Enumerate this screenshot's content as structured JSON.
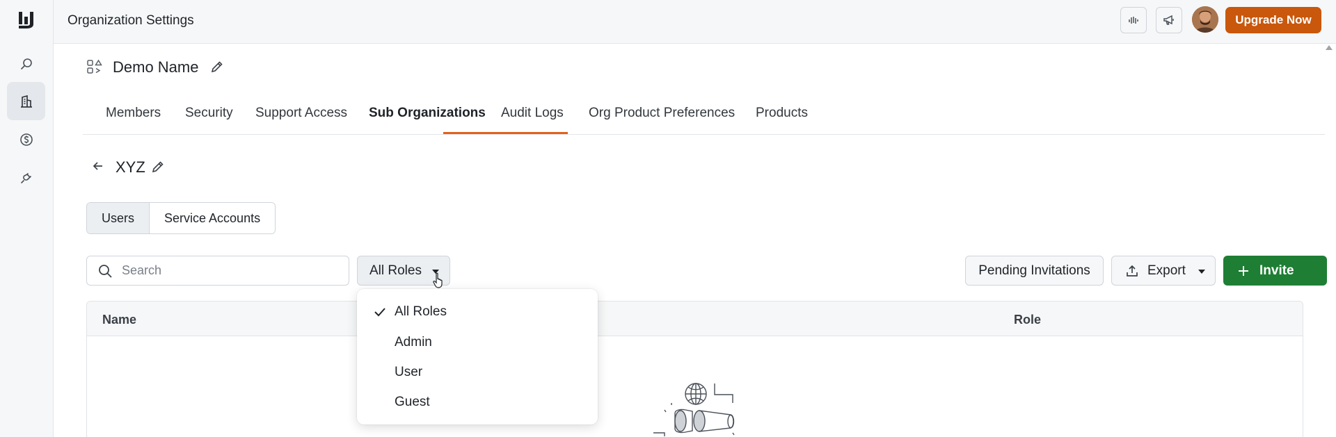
{
  "header": {
    "title": "Organization Settings",
    "upgrade_label": "Upgrade Now"
  },
  "rail": {
    "items": [
      {
        "icon": "search-icon",
        "active": false
      },
      {
        "icon": "building-icon",
        "active": true
      },
      {
        "icon": "dollar-circle-icon",
        "active": false
      },
      {
        "icon": "plug-icon",
        "active": false
      }
    ]
  },
  "org": {
    "name": "Demo Name"
  },
  "tabs": [
    {
      "label": "Members"
    },
    {
      "label": "Security"
    },
    {
      "label": "Support Access"
    },
    {
      "label": "Sub Organizations",
      "active": true
    },
    {
      "label": "Audit Logs"
    },
    {
      "label": "Org Product Preferences"
    },
    {
      "label": "Products"
    }
  ],
  "sub_org": {
    "name": "XYZ"
  },
  "segments": [
    {
      "label": "Users",
      "active": true
    },
    {
      "label": "Service Accounts"
    }
  ],
  "toolbar": {
    "search_placeholder": "Search",
    "roles_label": "All Roles",
    "pending_label": "Pending Invitations",
    "export_label": "Export",
    "invite_label": "Invite"
  },
  "table": {
    "columns": [
      "Name",
      "Role"
    ]
  },
  "roles_menu": {
    "selected": "All Roles",
    "options": [
      "All Roles",
      "Admin",
      "User",
      "Guest"
    ]
  },
  "colors": {
    "accent_orange": "#c9570c",
    "tab_underline": "#e2611a",
    "invite_green": "#1e7e34"
  }
}
